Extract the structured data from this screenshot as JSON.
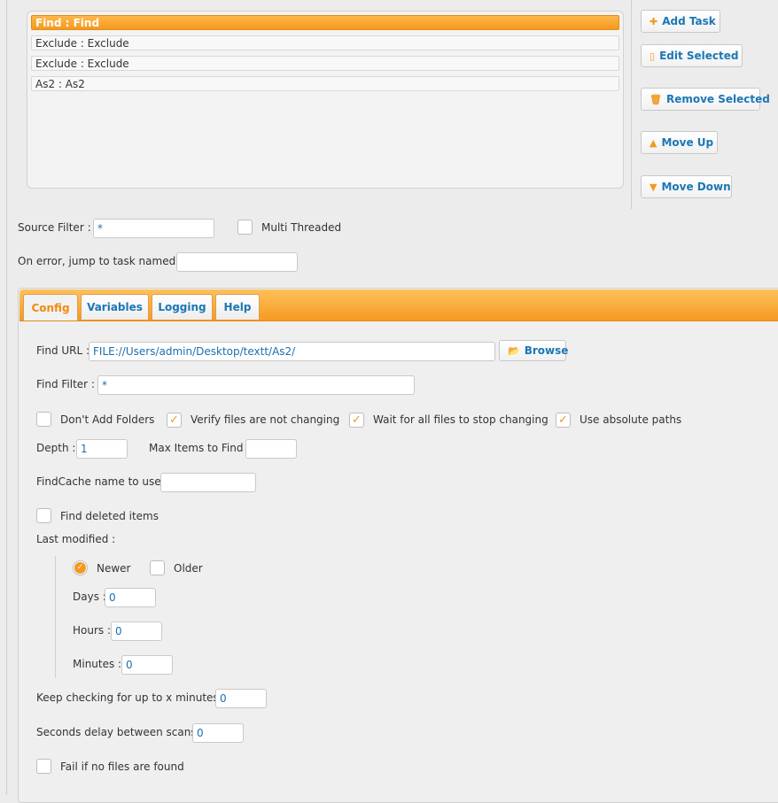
{
  "tasks": [
    {
      "label": "Find : Find",
      "selected": true
    },
    {
      "label": "Exclude : Exclude",
      "selected": false
    },
    {
      "label": "Exclude : Exclude",
      "selected": false
    },
    {
      "label": "As2 : As2",
      "selected": false
    }
  ],
  "buttons": {
    "add_task": "Add Task",
    "edit_selected": "Edit Selected",
    "remove_selected": "Remove Selected",
    "move_up": "Move Up",
    "move_down": "Move Down",
    "browse": "Browse"
  },
  "source_filter": {
    "label": "Source Filter :",
    "value": "*"
  },
  "multi_threaded": {
    "label": "Multi Threaded",
    "checked": false
  },
  "on_error": {
    "label": "On error, jump to task named :",
    "value": ""
  },
  "tabs": [
    {
      "label": "Config",
      "active": true
    },
    {
      "label": "Variables",
      "active": false
    },
    {
      "label": "Logging",
      "active": false
    },
    {
      "label": "Help",
      "active": false
    }
  ],
  "config": {
    "find_url": {
      "label": "Find URL :",
      "value": "FILE://Users/admin/Desktop/textt/As2/"
    },
    "find_filter": {
      "label": "Find Filter :",
      "value": "*"
    },
    "dont_add_folders": {
      "label": "Don't Add Folders",
      "checked": false
    },
    "verify_files": {
      "label": "Verify files are not changing",
      "checked": true
    },
    "wait_all_files": {
      "label": "Wait for all files to stop changing",
      "checked": true
    },
    "absolute_paths": {
      "label": "Use absolute paths",
      "checked": true
    },
    "depth": {
      "label": "Depth :",
      "value": "1"
    },
    "max_items": {
      "label": "Max Items to Find :",
      "value": ""
    },
    "findcache": {
      "label": "FindCache name to use :",
      "value": ""
    },
    "find_deleted": {
      "label": "Find deleted items",
      "checked": false
    },
    "last_modified": {
      "label": "Last modified :"
    },
    "newer": {
      "label": "Newer",
      "checked": true
    },
    "older": {
      "label": "Older",
      "checked": false
    },
    "days": {
      "label": "Days :",
      "value": "0"
    },
    "hours": {
      "label": "Hours :",
      "value": "0"
    },
    "minutes": {
      "label": "Minutes :",
      "value": "0"
    },
    "keep_checking": {
      "label": "Keep checking for up to x minutes :",
      "value": "0"
    },
    "seconds_delay": {
      "label": "Seconds delay between scans :",
      "value": "0"
    },
    "fail_no_files": {
      "label": "Fail if no files are found",
      "checked": false
    }
  },
  "colors": {
    "accent": "#f59a20",
    "link": "#1b77b5"
  }
}
